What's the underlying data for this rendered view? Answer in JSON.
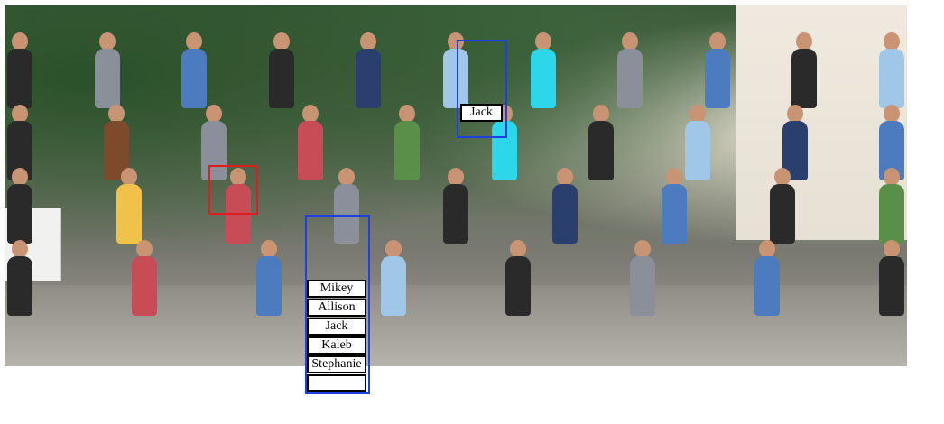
{
  "photo": {
    "description": "Group photo of people outdoors"
  },
  "labels": {
    "top_person": "Jack",
    "stack": [
      "Mikey",
      "Allison",
      "Jack",
      "Kaleb",
      "Stephanie",
      ""
    ]
  },
  "colors": {
    "blue_box": "#1f3fe0",
    "red_box": "#e01c1c",
    "label_text": "#000000",
    "label_background": "#ffffff"
  }
}
